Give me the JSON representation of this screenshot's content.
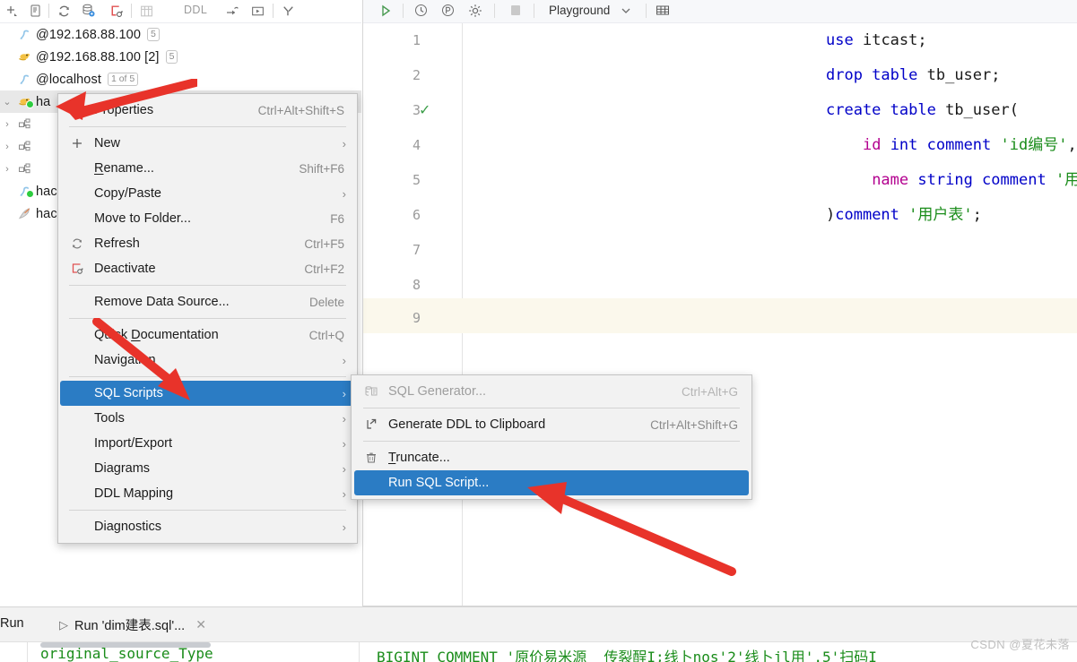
{
  "db_toolbar": {
    "icons": [
      "add-icon",
      "console-icon",
      "refresh-icon",
      "database-settings-icon",
      "deactivate-icon",
      "table-icon",
      "ddl-icon",
      "jump-to-icon",
      "run-icon",
      "filter-icon"
    ],
    "ddl_label": "DDL"
  },
  "tree": {
    "items": [
      {
        "label": "@192.168.88.100",
        "badge": "5",
        "icon": "hive-connection-icon",
        "arrow": "",
        "selected": false
      },
      {
        "label": "@192.168.88.100 [2]",
        "badge": "5",
        "icon": "mysql-dolphin-icon",
        "arrow": "",
        "selected": false
      },
      {
        "label": "@localhost",
        "badge": "1 of 5",
        "icon": "hive-connection-icon",
        "arrow": "",
        "selected": false
      },
      {
        "label": "ha",
        "badge": "",
        "icon": "mysql-dolphin-icon",
        "arrow": "v",
        "selected": true
      },
      {
        "label": "",
        "badge": "",
        "icon": "schema-icon",
        "arrow": ">",
        "selected": false
      },
      {
        "label": "",
        "badge": "",
        "icon": "schema-icon",
        "arrow": ">",
        "selected": false
      },
      {
        "label": "",
        "badge": "",
        "icon": "schema-icon",
        "arrow": ">",
        "selected": false
      },
      {
        "label": "hac",
        "badge": "",
        "icon": "hive-connection-icon",
        "arrow": "",
        "selected": false
      },
      {
        "label": "hac",
        "badge": "",
        "icon": "apache-feather-icon",
        "arrow": "",
        "selected": false
      }
    ]
  },
  "editor": {
    "toolbar": {
      "icons": [
        "execute-icon",
        "history-icon",
        "parameters-icon",
        "settings-icon",
        "stop-icon",
        "grid-icon"
      ],
      "schema_selector": "Playground",
      "schema_chevron": "chevron-down-icon"
    },
    "lines": [
      {
        "num": "1",
        "check": false,
        "tokens": [
          [
            "kw",
            "use"
          ],
          [
            "pun",
            " "
          ],
          [
            "id",
            "itcast;"
          ]
        ]
      },
      {
        "num": "2",
        "check": false,
        "tokens": [
          [
            "kw",
            "drop table"
          ],
          [
            "pun",
            " "
          ],
          [
            "id",
            "tb_user;"
          ]
        ]
      },
      {
        "num": "3",
        "check": true,
        "tokens": [
          [
            "kw",
            "create table"
          ],
          [
            "pun",
            " "
          ],
          [
            "id",
            "tb_user("
          ]
        ]
      },
      {
        "num": "4",
        "check": false,
        "tokens": [
          [
            "pun",
            "    "
          ],
          [
            "fn",
            "id"
          ],
          [
            "pun",
            " "
          ],
          [
            "kw",
            "int comment"
          ],
          [
            "pun",
            " "
          ],
          [
            "str",
            "'id编号'"
          ],
          [
            "pun",
            ","
          ]
        ]
      },
      {
        "num": "5",
        "check": false,
        "tokens": [
          [
            "pun",
            "     "
          ],
          [
            "fn",
            "name"
          ],
          [
            "pun",
            " "
          ],
          [
            "kw",
            "string comment"
          ],
          [
            "pun",
            " "
          ],
          [
            "str",
            "'用户名'"
          ]
        ]
      },
      {
        "num": "6",
        "check": false,
        "tokens": [
          [
            "pun",
            ")"
          ],
          [
            "kw",
            "comment"
          ],
          [
            "pun",
            " "
          ],
          [
            "str",
            "'用户表'"
          ],
          [
            "pun",
            ";"
          ]
        ]
      },
      {
        "num": "7",
        "check": false,
        "tokens": []
      },
      {
        "num": "8",
        "check": false,
        "tokens": []
      },
      {
        "num": "9",
        "check": false,
        "tokens": []
      }
    ],
    "highlighted_line": "9"
  },
  "context_menu": {
    "items": [
      {
        "label": "Properties",
        "accel": "Ctrl+Alt+Shift+S",
        "icon": "properties-icon",
        "arrow": false,
        "selected": false,
        "mnemonic": ""
      },
      {
        "sep": true
      },
      {
        "label": "New",
        "accel": "",
        "icon": "plus-icon",
        "arrow": true,
        "selected": false,
        "mnemonic": ""
      },
      {
        "label": "Rename...",
        "accel": "Shift+F6",
        "icon": "",
        "arrow": false,
        "selected": false,
        "mnemonic": "R"
      },
      {
        "label": "Copy/Paste",
        "accel": "",
        "icon": "",
        "arrow": true,
        "selected": false,
        "mnemonic": ""
      },
      {
        "label": "Move to Folder...",
        "accel": "F6",
        "icon": "",
        "arrow": false,
        "selected": false,
        "mnemonic": ""
      },
      {
        "label": "Refresh",
        "accel": "Ctrl+F5",
        "icon": "refresh-icon",
        "arrow": false,
        "selected": false,
        "mnemonic": ""
      },
      {
        "label": "Deactivate",
        "accel": "Ctrl+F2",
        "icon": "deactivate-icon",
        "arrow": false,
        "selected": false,
        "mnemonic": ""
      },
      {
        "sep": true
      },
      {
        "label": "Remove Data Source...",
        "accel": "Delete",
        "icon": "",
        "arrow": false,
        "selected": false,
        "mnemonic": ""
      },
      {
        "sep": true
      },
      {
        "label": "Quick Documentation",
        "accel": "Ctrl+Q",
        "icon": "",
        "arrow": false,
        "selected": false,
        "mnemonic": "D"
      },
      {
        "label": "Navigation",
        "accel": "",
        "icon": "",
        "arrow": true,
        "selected": false,
        "mnemonic": ""
      },
      {
        "sep": true
      },
      {
        "label": "SQL Scripts",
        "accel": "",
        "icon": "",
        "arrow": true,
        "selected": true,
        "mnemonic": ""
      },
      {
        "label": "Tools",
        "accel": "",
        "icon": "",
        "arrow": true,
        "selected": false,
        "mnemonic": ""
      },
      {
        "label": "Import/Export",
        "accel": "",
        "icon": "",
        "arrow": true,
        "selected": false,
        "mnemonic": ""
      },
      {
        "label": "Diagrams",
        "accel": "",
        "icon": "",
        "arrow": true,
        "selected": false,
        "mnemonic": ""
      },
      {
        "label": "DDL Mapping",
        "accel": "",
        "icon": "",
        "arrow": true,
        "selected": false,
        "mnemonic": ""
      },
      {
        "sep": true
      },
      {
        "label": "Diagnostics",
        "accel": "",
        "icon": "",
        "arrow": true,
        "selected": false,
        "mnemonic": ""
      }
    ]
  },
  "sub_menu": {
    "items": [
      {
        "label": "SQL Generator...",
        "accel": "Ctrl+Alt+G",
        "icon": "sql-generator-icon",
        "selected": false,
        "disabled": true,
        "mnemonic": ""
      },
      {
        "sep": true
      },
      {
        "label": "Generate DDL to Clipboard",
        "accel": "Ctrl+Alt+Shift+G",
        "icon": "export-arrow-icon",
        "selected": false,
        "disabled": false,
        "mnemonic": ""
      },
      {
        "sep": true
      },
      {
        "label": "Truncate...",
        "accel": "",
        "icon": "trash-icon",
        "selected": false,
        "disabled": false,
        "mnemonic": "T"
      },
      {
        "label": "Run SQL Script...",
        "accel": "",
        "icon": "",
        "selected": true,
        "disabled": false,
        "mnemonic": ""
      }
    ]
  },
  "bottom": {
    "run_label": "Run",
    "run_tab": "Run 'dim建表.sql'...",
    "run_tab_icon": "play-triangle-icon",
    "close_icon": "close-icon",
    "console_left": "original_source_Type",
    "console_right": "BIGINT COMMENT '原价易米源  传裂酲I;线卜nos'2'线卜jl用'.5'扫码I"
  },
  "watermark": "CSDN @夏花未落",
  "colors": {
    "accent_blue": "#2b7cc4",
    "arrow_red": "#e8332a",
    "selection_grey": "#e8e8e8",
    "menu_bg": "#f2f2f2",
    "line_highlight": "#fbf8ec",
    "keyword": "#0000c8",
    "string": "#1a8c1a",
    "function": "#b3008f"
  }
}
